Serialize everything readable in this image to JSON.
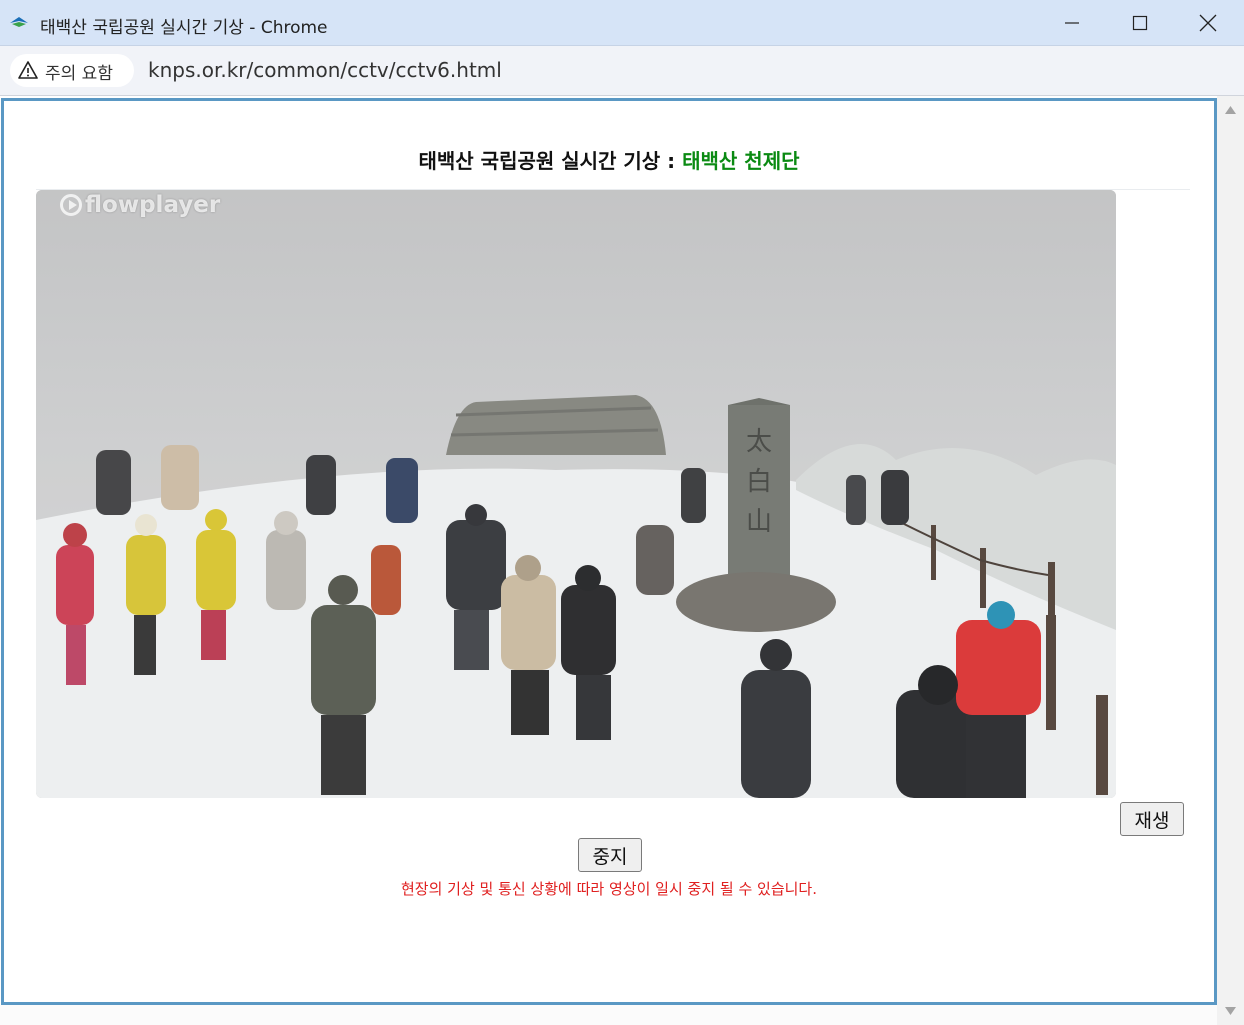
{
  "window": {
    "title": "태백산 국립공원 실시간 기상 - Chrome",
    "icon": "mountain-logo-icon"
  },
  "addressbar": {
    "security_label": "주의 요함",
    "url": "knps.or.kr/common/cctv/cctv6.html"
  },
  "page": {
    "title_prefix": "태백산 국립공원 실시간 기상 : ",
    "title_location": "태백산 천제단",
    "player_logo": "flowplayer",
    "play_button": "재생",
    "stop_button": "중지",
    "notice": "현장의 기상 및 통신 상황에 따라 영상이 일시 중지 될 수 있습니다."
  },
  "colors": {
    "frame_border": "#5a98c4",
    "location_text": "#0a8a12",
    "notice_text": "#e02020"
  }
}
